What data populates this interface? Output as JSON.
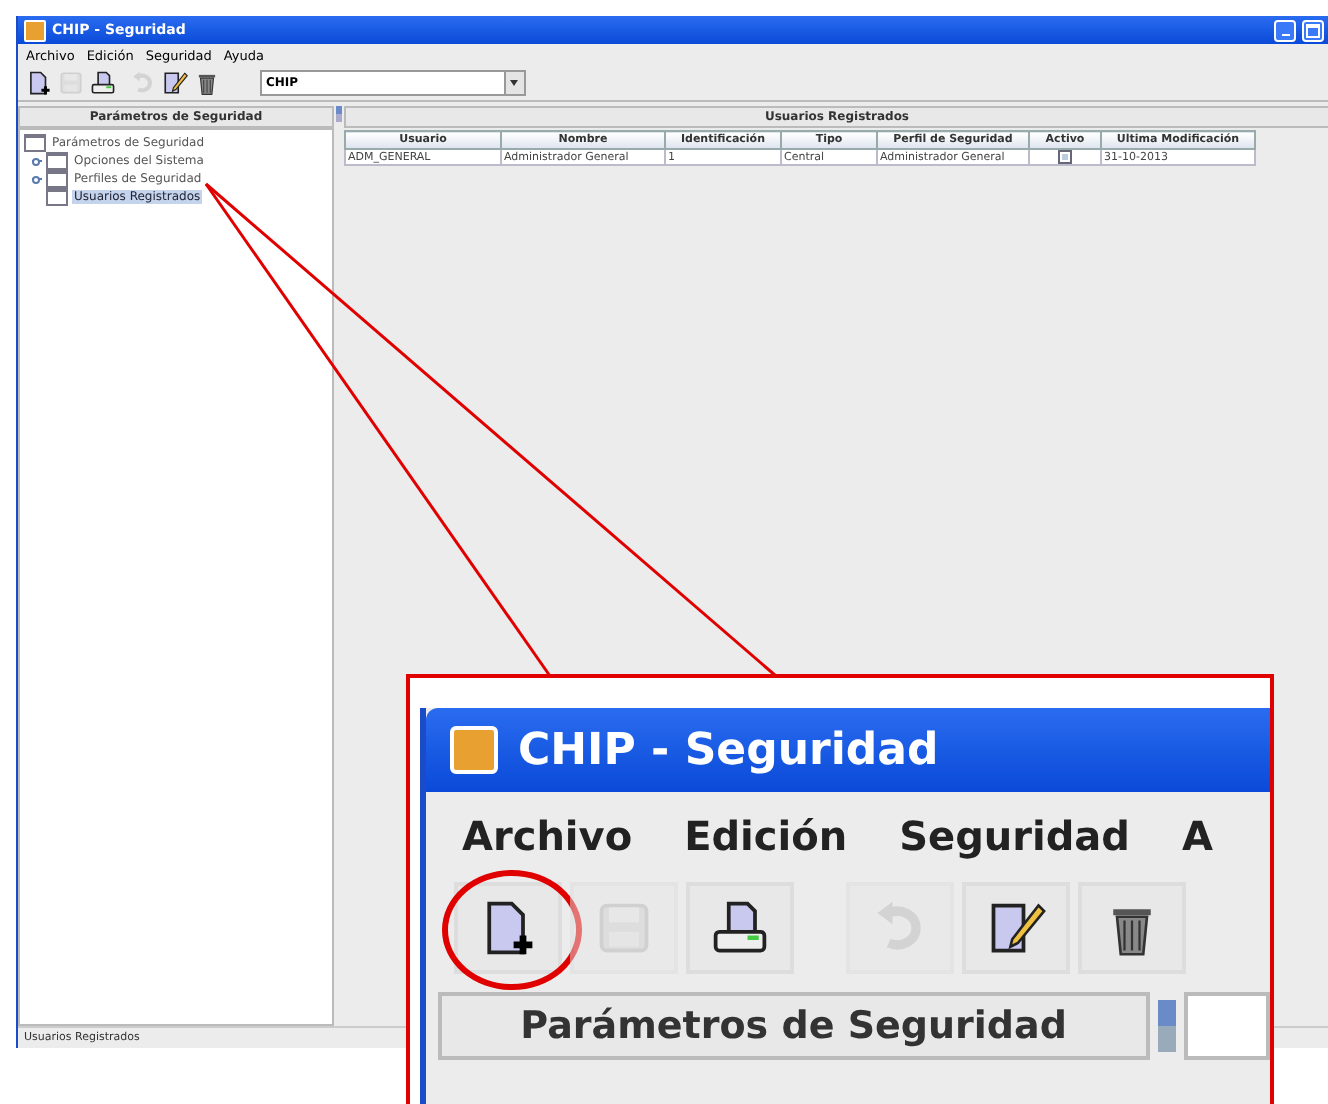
{
  "window": {
    "title": "CHIP - Seguridad"
  },
  "menu": [
    "Archivo",
    "Edición",
    "Seguridad",
    "Ayuda"
  ],
  "toolbar": [
    {
      "kind": "new",
      "disabled": false
    },
    {
      "kind": "save",
      "disabled": true
    },
    {
      "kind": "print",
      "disabled": false
    },
    {
      "kind": "undo",
      "disabled": true
    },
    {
      "kind": "edit",
      "disabled": false
    },
    {
      "kind": "delete",
      "disabled": false
    }
  ],
  "combo": {
    "value": "CHIP"
  },
  "tree_panel": {
    "title": "Parámetros de Seguridad",
    "tree": [
      {
        "label": "Parámetros de Seguridad",
        "expanded": true,
        "selected": false,
        "children": [
          {
            "label": "Opciones del Sistema",
            "expanded": false,
            "selected": false
          },
          {
            "label": "Perfiles de Seguridad",
            "expanded": false,
            "selected": false
          },
          {
            "label": "Usuarios Registrados",
            "selected": true
          }
        ]
      }
    ]
  },
  "table_panel": {
    "title": "Usuarios Registrados"
  },
  "table": {
    "columns": [
      "Usuario",
      "Nombre",
      "Identificación",
      "Tipo",
      "Perfil de Seguridad",
      "Activo",
      "Ultima Modificación"
    ],
    "rows": [
      {
        "cells": [
          "ADM_GENERAL",
          "Administrador General",
          "1",
          "Central",
          "Administrador General"
        ],
        "active": true,
        "modified": "31-10-2013"
      }
    ]
  },
  "status_bar": "Usuarios Registrados",
  "callout": {
    "title": "CHIP - Seguridad",
    "menu": [
      "Archivo",
      "Edición",
      "Seguridad",
      "A"
    ],
    "toolbar": [
      {
        "kind": "new",
        "disabled": false,
        "circled": true
      },
      {
        "kind": "save",
        "disabled": true,
        "circled": false
      },
      {
        "kind": "print",
        "disabled": false,
        "circled": false
      },
      {
        "kind": "undo",
        "disabled": true,
        "circled": false
      },
      {
        "kind": "edit",
        "disabled": false,
        "circled": false
      },
      {
        "kind": "delete",
        "disabled": false,
        "circled": false
      }
    ],
    "panel_title": "Parámetros de Seguridad"
  }
}
